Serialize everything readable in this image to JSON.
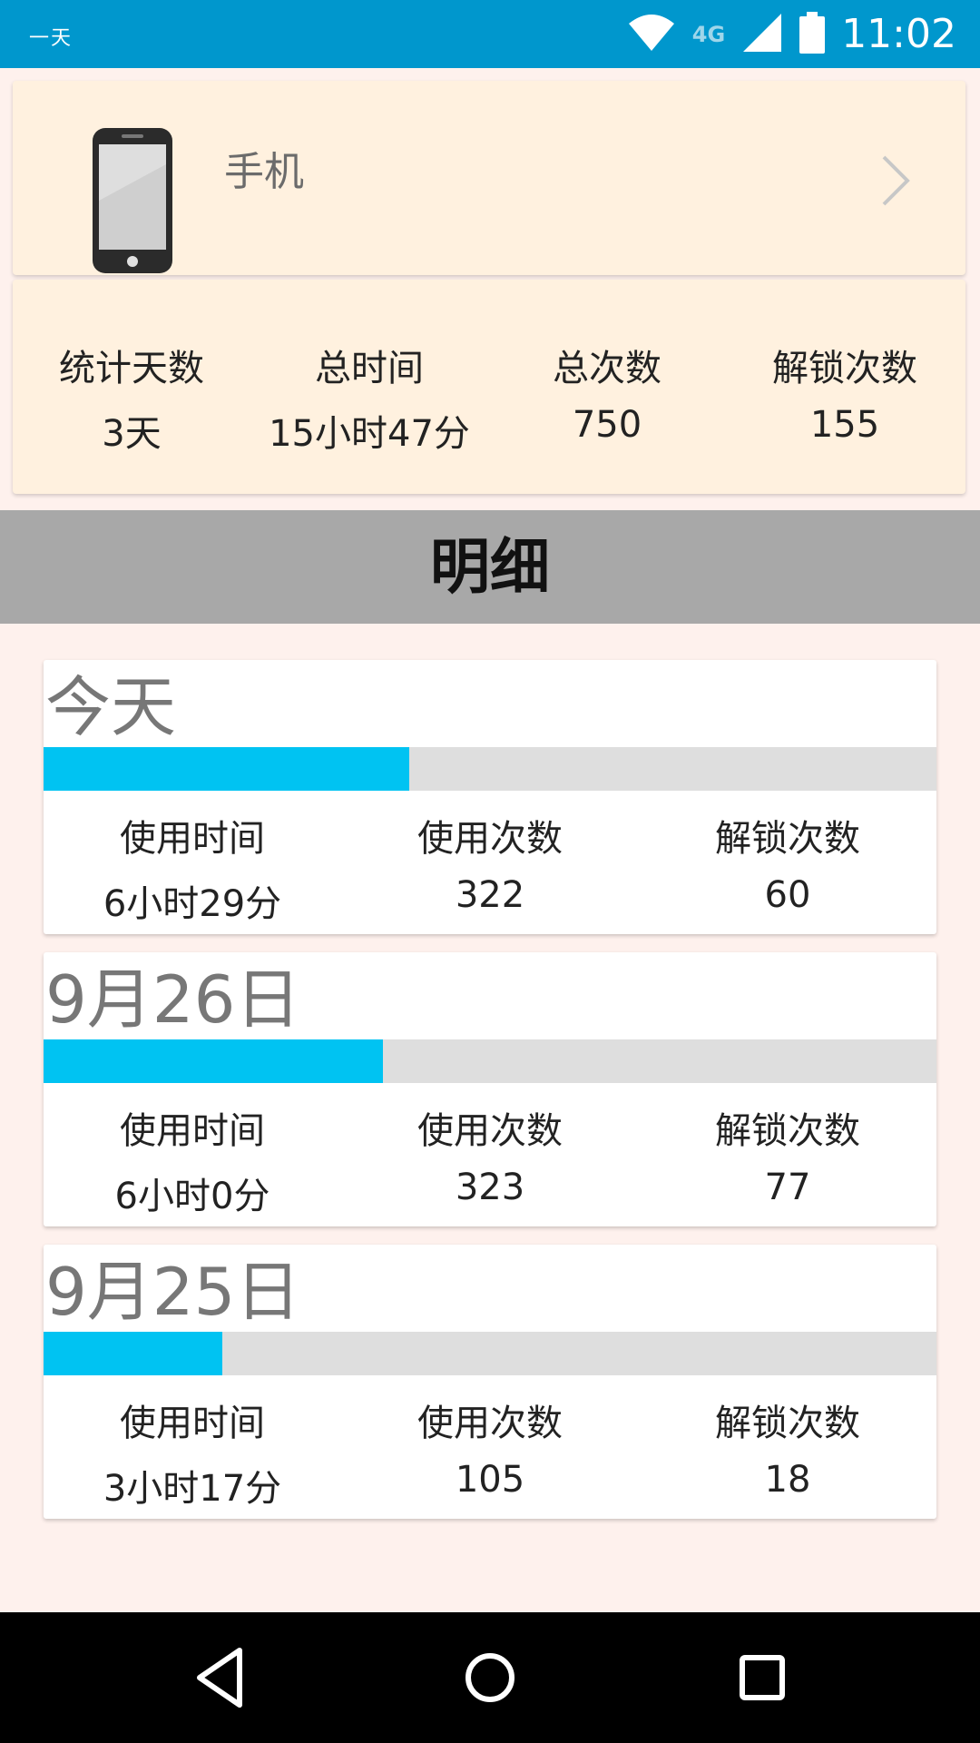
{
  "status_bar": {
    "left_text": "一天",
    "network_label": "4G",
    "time": "11:02"
  },
  "device": {
    "name": "手机"
  },
  "summary": {
    "stats": [
      {
        "label": "统计天数",
        "value": "3天"
      },
      {
        "label": "总时间",
        "value": "15小时47分"
      },
      {
        "label": "总次数",
        "value": "750"
      },
      {
        "label": "解锁次数",
        "value": "155"
      }
    ]
  },
  "section": {
    "title": "明细"
  },
  "days": [
    {
      "title": "今天",
      "progress": 0.41,
      "stats": [
        {
          "label": "使用时间",
          "value": "6小时29分"
        },
        {
          "label": "使用次数",
          "value": "322"
        },
        {
          "label": "解锁次数",
          "value": "60"
        }
      ]
    },
    {
      "title": "9月26日",
      "progress": 0.38,
      "stats": [
        {
          "label": "使用时间",
          "value": "6小时0分"
        },
        {
          "label": "使用次数",
          "value": "323"
        },
        {
          "label": "解锁次数",
          "value": "77"
        }
      ]
    },
    {
      "title": "9月25日",
      "progress": 0.2,
      "stats": [
        {
          "label": "使用时间",
          "value": "3小时17分"
        },
        {
          "label": "使用次数",
          "value": "105"
        },
        {
          "label": "解锁次数",
          "value": "18"
        }
      ]
    }
  ],
  "colors": {
    "status_bar": "#0097cd",
    "progress_fill": "#00c3f2",
    "progress_track": "#dedede",
    "summary_card": "#fff1df",
    "page_background": "#fef1ed"
  },
  "icons": {
    "wifi": "wifi-icon",
    "signal": "cell-signal-icon",
    "battery": "battery-icon",
    "device": "smartphone-icon",
    "chevron": "chevron-right-icon",
    "nav_back": "back-triangle-icon",
    "nav_home": "home-circle-icon",
    "nav_recents": "recents-square-icon"
  }
}
